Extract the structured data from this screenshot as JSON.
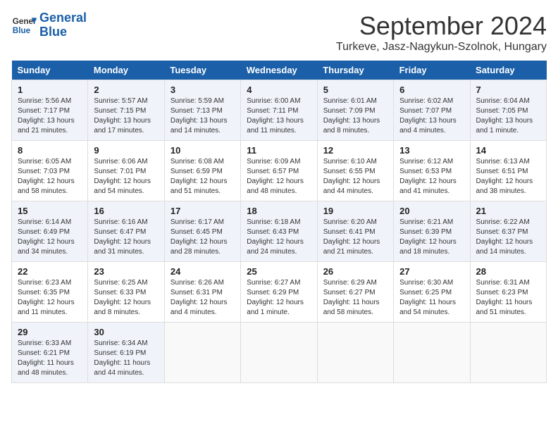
{
  "header": {
    "logo_line1": "General",
    "logo_line2": "Blue",
    "month_title": "September 2024",
    "location": "Turkeve, Jasz-Nagykun-Szolnok, Hungary"
  },
  "weekdays": [
    "Sunday",
    "Monday",
    "Tuesday",
    "Wednesday",
    "Thursday",
    "Friday",
    "Saturday"
  ],
  "weeks": [
    [
      {
        "day": "1",
        "sunrise": "Sunrise: 5:56 AM",
        "sunset": "Sunset: 7:17 PM",
        "daylight": "Daylight: 13 hours and 21 minutes."
      },
      {
        "day": "2",
        "sunrise": "Sunrise: 5:57 AM",
        "sunset": "Sunset: 7:15 PM",
        "daylight": "Daylight: 13 hours and 17 minutes."
      },
      {
        "day": "3",
        "sunrise": "Sunrise: 5:59 AM",
        "sunset": "Sunset: 7:13 PM",
        "daylight": "Daylight: 13 hours and 14 minutes."
      },
      {
        "day": "4",
        "sunrise": "Sunrise: 6:00 AM",
        "sunset": "Sunset: 7:11 PM",
        "daylight": "Daylight: 13 hours and 11 minutes."
      },
      {
        "day": "5",
        "sunrise": "Sunrise: 6:01 AM",
        "sunset": "Sunset: 7:09 PM",
        "daylight": "Daylight: 13 hours and 8 minutes."
      },
      {
        "day": "6",
        "sunrise": "Sunrise: 6:02 AM",
        "sunset": "Sunset: 7:07 PM",
        "daylight": "Daylight: 13 hours and 4 minutes."
      },
      {
        "day": "7",
        "sunrise": "Sunrise: 6:04 AM",
        "sunset": "Sunset: 7:05 PM",
        "daylight": "Daylight: 13 hours and 1 minute."
      }
    ],
    [
      {
        "day": "8",
        "sunrise": "Sunrise: 6:05 AM",
        "sunset": "Sunset: 7:03 PM",
        "daylight": "Daylight: 12 hours and 58 minutes."
      },
      {
        "day": "9",
        "sunrise": "Sunrise: 6:06 AM",
        "sunset": "Sunset: 7:01 PM",
        "daylight": "Daylight: 12 hours and 54 minutes."
      },
      {
        "day": "10",
        "sunrise": "Sunrise: 6:08 AM",
        "sunset": "Sunset: 6:59 PM",
        "daylight": "Daylight: 12 hours and 51 minutes."
      },
      {
        "day": "11",
        "sunrise": "Sunrise: 6:09 AM",
        "sunset": "Sunset: 6:57 PM",
        "daylight": "Daylight: 12 hours and 48 minutes."
      },
      {
        "day": "12",
        "sunrise": "Sunrise: 6:10 AM",
        "sunset": "Sunset: 6:55 PM",
        "daylight": "Daylight: 12 hours and 44 minutes."
      },
      {
        "day": "13",
        "sunrise": "Sunrise: 6:12 AM",
        "sunset": "Sunset: 6:53 PM",
        "daylight": "Daylight: 12 hours and 41 minutes."
      },
      {
        "day": "14",
        "sunrise": "Sunrise: 6:13 AM",
        "sunset": "Sunset: 6:51 PM",
        "daylight": "Daylight: 12 hours and 38 minutes."
      }
    ],
    [
      {
        "day": "15",
        "sunrise": "Sunrise: 6:14 AM",
        "sunset": "Sunset: 6:49 PM",
        "daylight": "Daylight: 12 hours and 34 minutes."
      },
      {
        "day": "16",
        "sunrise": "Sunrise: 6:16 AM",
        "sunset": "Sunset: 6:47 PM",
        "daylight": "Daylight: 12 hours and 31 minutes."
      },
      {
        "day": "17",
        "sunrise": "Sunrise: 6:17 AM",
        "sunset": "Sunset: 6:45 PM",
        "daylight": "Daylight: 12 hours and 28 minutes."
      },
      {
        "day": "18",
        "sunrise": "Sunrise: 6:18 AM",
        "sunset": "Sunset: 6:43 PM",
        "daylight": "Daylight: 12 hours and 24 minutes."
      },
      {
        "day": "19",
        "sunrise": "Sunrise: 6:20 AM",
        "sunset": "Sunset: 6:41 PM",
        "daylight": "Daylight: 12 hours and 21 minutes."
      },
      {
        "day": "20",
        "sunrise": "Sunrise: 6:21 AM",
        "sunset": "Sunset: 6:39 PM",
        "daylight": "Daylight: 12 hours and 18 minutes."
      },
      {
        "day": "21",
        "sunrise": "Sunrise: 6:22 AM",
        "sunset": "Sunset: 6:37 PM",
        "daylight": "Daylight: 12 hours and 14 minutes."
      }
    ],
    [
      {
        "day": "22",
        "sunrise": "Sunrise: 6:23 AM",
        "sunset": "Sunset: 6:35 PM",
        "daylight": "Daylight: 12 hours and 11 minutes."
      },
      {
        "day": "23",
        "sunrise": "Sunrise: 6:25 AM",
        "sunset": "Sunset: 6:33 PM",
        "daylight": "Daylight: 12 hours and 8 minutes."
      },
      {
        "day": "24",
        "sunrise": "Sunrise: 6:26 AM",
        "sunset": "Sunset: 6:31 PM",
        "daylight": "Daylight: 12 hours and 4 minutes."
      },
      {
        "day": "25",
        "sunrise": "Sunrise: 6:27 AM",
        "sunset": "Sunset: 6:29 PM",
        "daylight": "Daylight: 12 hours and 1 minute."
      },
      {
        "day": "26",
        "sunrise": "Sunrise: 6:29 AM",
        "sunset": "Sunset: 6:27 PM",
        "daylight": "Daylight: 11 hours and 58 minutes."
      },
      {
        "day": "27",
        "sunrise": "Sunrise: 6:30 AM",
        "sunset": "Sunset: 6:25 PM",
        "daylight": "Daylight: 11 hours and 54 minutes."
      },
      {
        "day": "28",
        "sunrise": "Sunrise: 6:31 AM",
        "sunset": "Sunset: 6:23 PM",
        "daylight": "Daylight: 11 hours and 51 minutes."
      }
    ],
    [
      {
        "day": "29",
        "sunrise": "Sunrise: 6:33 AM",
        "sunset": "Sunset: 6:21 PM",
        "daylight": "Daylight: 11 hours and 48 minutes."
      },
      {
        "day": "30",
        "sunrise": "Sunrise: 6:34 AM",
        "sunset": "Sunset: 6:19 PM",
        "daylight": "Daylight: 11 hours and 44 minutes."
      },
      null,
      null,
      null,
      null,
      null
    ]
  ]
}
